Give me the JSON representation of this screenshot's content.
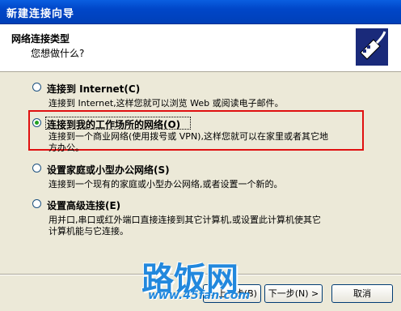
{
  "window": {
    "title": "新建连接向导"
  },
  "header": {
    "title": "网络连接类型",
    "subtitle": "您想做什么?",
    "icon": "network-cable-icon"
  },
  "options": [
    {
      "label": "连接到 Internet(C)",
      "desc1": "连接到 Internet,这样您就可以浏览 Web 或阅读电子邮件。",
      "desc2": "",
      "checked": false
    },
    {
      "label": "连接到我的工作场所的网络(O)",
      "desc1": "连接到一个商业网络(使用拨号或 VPN),这样您就可以在家里或者其它地",
      "desc2": "方办公。",
      "checked": true
    },
    {
      "label": "设置家庭或小型办公网络(S)",
      "desc1": "连接到一个现有的家庭或小型办公网络,或者设置一个新的。",
      "desc2": "",
      "checked": false
    },
    {
      "label": "设置高级连接(E)",
      "desc1": "用并口,串口或红外端口直接连接到其它计算机,或设置此计算机使其它",
      "desc2": "计算机能与它连接。",
      "checked": false
    }
  ],
  "buttons": {
    "back": "< 上一步(B)",
    "next": "下一步(N) >",
    "cancel": "取消"
  },
  "watermark": {
    "text": "路饭网",
    "url": "www.45fan.com"
  }
}
